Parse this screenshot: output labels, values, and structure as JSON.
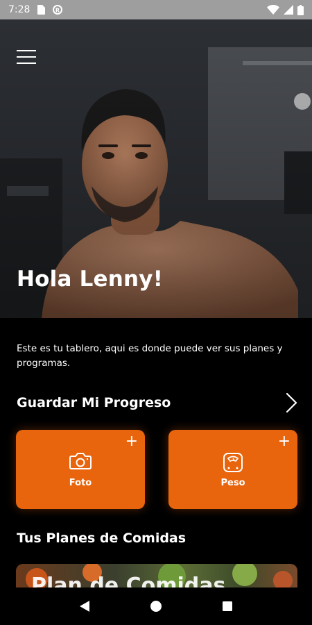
{
  "status_bar": {
    "time": "7:28",
    "icons": [
      "sim-card-icon",
      "data-saver-icon",
      "wifi-icon",
      "signal-icon",
      "battery-icon"
    ]
  },
  "header": {
    "menu_icon": "hamburger-menu-icon",
    "greeting": "Hola Lenny!"
  },
  "intro_text": "Este es tu tablero, aqui es donde puede ver sus planes y programas.",
  "progress_section": {
    "title": "Guardar Mi Progreso",
    "chevron_icon": "chevron-right-icon",
    "cards": [
      {
        "label": "Foto",
        "icon": "camera-icon",
        "add_symbol": "+"
      },
      {
        "label": "Peso",
        "icon": "scale-icon",
        "add_symbol": "+"
      }
    ]
  },
  "meal_section": {
    "title": "Tus Planes de Comidas",
    "card_title": "Plan de Comidas"
  },
  "nav_bar": {
    "icons": [
      "back-triangle-icon",
      "home-circle-icon",
      "recents-square-icon"
    ]
  },
  "colors": {
    "accent": "#e8650e",
    "background": "#000000",
    "status_bar": "#9e9e9e"
  }
}
